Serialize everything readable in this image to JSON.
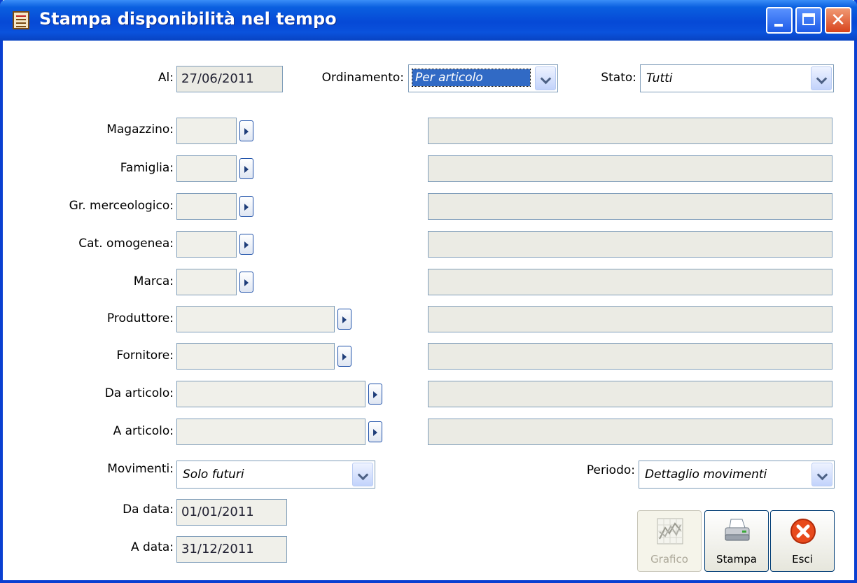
{
  "window": {
    "title": "Stampa disponibilità nel tempo"
  },
  "header": {
    "al_label": "Al:",
    "al_value": "27/06/2011",
    "ordinamento_label": "Ordinamento:",
    "ordinamento_value": "Per articolo",
    "stato_label": "Stato:",
    "stato_value": "Tutti"
  },
  "filters": [
    {
      "label": "Magazzino:"
    },
    {
      "label": "Famiglia:"
    },
    {
      "label": "Gr. merceologico:"
    },
    {
      "label": "Cat. omogenea:"
    },
    {
      "label": "Marca:"
    },
    {
      "label": "Produttore:"
    },
    {
      "label": "Fornitore:"
    },
    {
      "label": "Da articolo:"
    },
    {
      "label": "A articolo:"
    }
  ],
  "movimenti": {
    "label": "Movimenti:",
    "value": "Solo futuri"
  },
  "periodo": {
    "label": "Periodo:",
    "value": "Dettaglio movimenti"
  },
  "dates": {
    "da_label": "Da data:",
    "da_value": "01/01/2011",
    "a_label": "A data:",
    "a_value": "31/12/2011"
  },
  "buttons": {
    "grafico": "Grafico",
    "stampa": "Stampa",
    "esci": "Esci"
  },
  "colors": {
    "titlebar": "#0a52dc",
    "field_border": "#7f9db9",
    "selection": "#316ac5",
    "close": "#d8431c"
  },
  "icons": {
    "app": "report-icon",
    "grafico": "chart-icon",
    "stampa": "printer-icon",
    "esci": "exit-icon"
  }
}
